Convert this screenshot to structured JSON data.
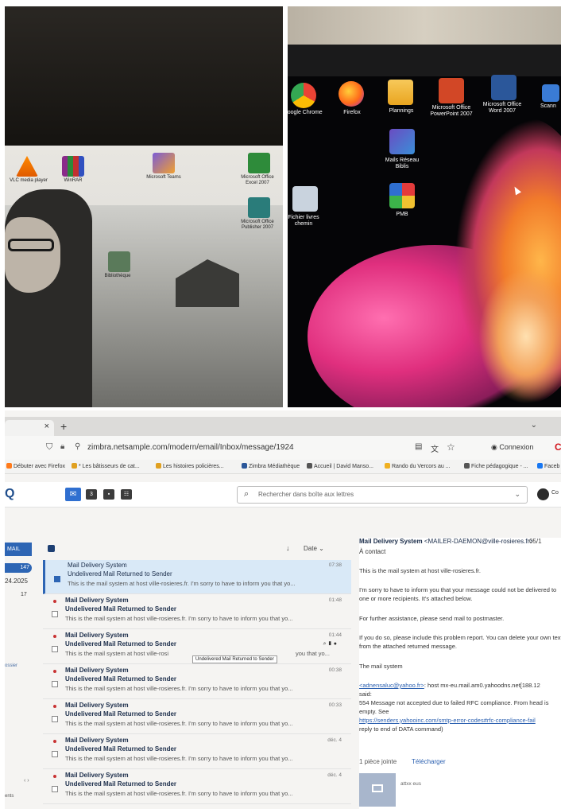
{
  "photo_desktop_left": {
    "icons": [
      "VLC media player",
      "WinRAR",
      "Microsoft Teams",
      "Microsoft Office Excel 2007",
      "Microsoft Office Publisher 2007",
      "Bibliothèque"
    ],
    "colors": {
      "wallpaper_sky": "#d6d4cf",
      "wallpaper_dark": "#2b2a28"
    }
  },
  "photo_desktop_right": {
    "icons": [
      {
        "label": "Google Chrome",
        "icon": "chrome-icon"
      },
      {
        "label": "Firefox",
        "icon": "firefox-icon"
      },
      {
        "label": "Plannings",
        "icon": "folder-icon"
      },
      {
        "label": "Microsoft Office PowerPoint 2007",
        "icon": "powerpoint-icon"
      },
      {
        "label": "Microsoft Office Word 2007",
        "icon": "word-icon"
      },
      {
        "label": "Scann",
        "icon": "scanner-icon"
      },
      {
        "label": "Mails Réseau Biblis",
        "icon": "mail-network-icon"
      },
      {
        "label": "Fichier livres chemin",
        "icon": "file-icon"
      },
      {
        "label": "PMB",
        "icon": "pmb-icon"
      }
    ],
    "colors": {
      "pink": "#e02f7e",
      "orange": "#f27c2a"
    }
  },
  "browser": {
    "tab_close": "×",
    "tab_new": "+",
    "url": "zimbra.netsample.com/modern/email/Inbox/message/1924",
    "account": "Connexion",
    "bookmarks": [
      "Débuter avec Firefox",
      "* Les bâtisseurs de cat...",
      "Les histoires policières...",
      "Zimbra Médiathèque",
      "Accueil | David Manso...",
      "Rando du Vercors au ...",
      "Fiche pédagogique - ...",
      "Faceb"
    ]
  },
  "app": {
    "search_placeholder": "Rechercher dans boîte aux lettres",
    "user_label": "Co",
    "nav": {
      "mail": "MAIL",
      "inbox_count": "147",
      "date": "24.2025",
      "count": "17",
      "dossier": "ossier",
      "pager": "‹  ›",
      "bottom": "ents"
    },
    "list_sort": "↓",
    "list_date": "Date ⌄"
  },
  "messages": [
    {
      "from": "Mail Delivery System",
      "subject": "Undelivered Mail Returned to Sender",
      "preview": "This is the mail system at host ville-rosieres.fr. I'm sorry to have to inform you that yo...",
      "time": "07:38",
      "selected": true
    },
    {
      "from": "Mail Delivery System",
      "subject": "Undelivered Mail Returned to Sender",
      "preview": "This is the mail system at host ville-rosieres.fr. I'm sorry to have to inform you that yo...",
      "time": "01:48",
      "selected": false
    },
    {
      "from": "Mail Delivery System",
      "subject": "Undelivered Mail Returned to Sender",
      "preview": "This is the mail system at host ville-rosi",
      "time": "01:44",
      "selected": false,
      "tooltip": "Undelivered Mail Returned to Sender",
      "tail": "you that yo..."
    },
    {
      "from": "Mail Delivery System",
      "subject": "Undelivered Mail Returned to Sender",
      "preview": "This is the mail system at host ville-rosieres.fr. I'm sorry to have to inform you that yo...",
      "time": "00:38",
      "selected": false
    },
    {
      "from": "Mail Delivery System",
      "subject": "Undelivered Mail Returned to Sender",
      "preview": "This is the mail system at host ville-rosieres.fr. I'm sorry to have to inform you that yo...",
      "time": "00:33",
      "selected": false
    },
    {
      "from": "Mail Delivery System",
      "subject": "Undelivered Mail Returned to Sender",
      "preview": "This is the mail system at host ville-rosieres.fr. I'm sorry to have to inform you that yo...",
      "time": "déc. 4",
      "selected": false
    },
    {
      "from": "Mail Delivery System",
      "subject": "Undelivered Mail Returned to Sender",
      "preview": "This is the mail system at host ville-rosieres.fr. I'm sorry to have to inform you that yo...",
      "time": "déc. 4",
      "selected": false
    }
  ],
  "reader": {
    "from_name": "Mail Delivery System",
    "from_addr": "<MAILER-DAEMON@ville-rosieres.fr>",
    "date": "05/1",
    "to": "À  contact",
    "p1": "This is the mail system at host ville-rosieres.fr.",
    "p2": "I'm sorry to have to inform you that your message could not be delivered to one or more recipients. It's attached below.",
    "p3": "For further assistance, please send mail to postmaster.",
    "p4": "If you do so, please include this problem report. You can delete your own text from the attached returned message.",
    "p5": "The mail system",
    "p6_link": "<adnensaluc@yahoo.fr>",
    "p6_rest": ": host mx-eu.mail.am0.yahoodns.net[188.12",
    "p7": "said:",
    "p8": "554 Message not accepted due to failed RFC compliance. From head is empty. See",
    "p9_link": "https://senders.yahooinc.com/smtp-error-codes#rfc-compliance-fail",
    "p10": "reply to end of DATA command)",
    "attach": "1 pièce jointe",
    "download": "Télécharger",
    "thumb_name": "attxx eus"
  }
}
